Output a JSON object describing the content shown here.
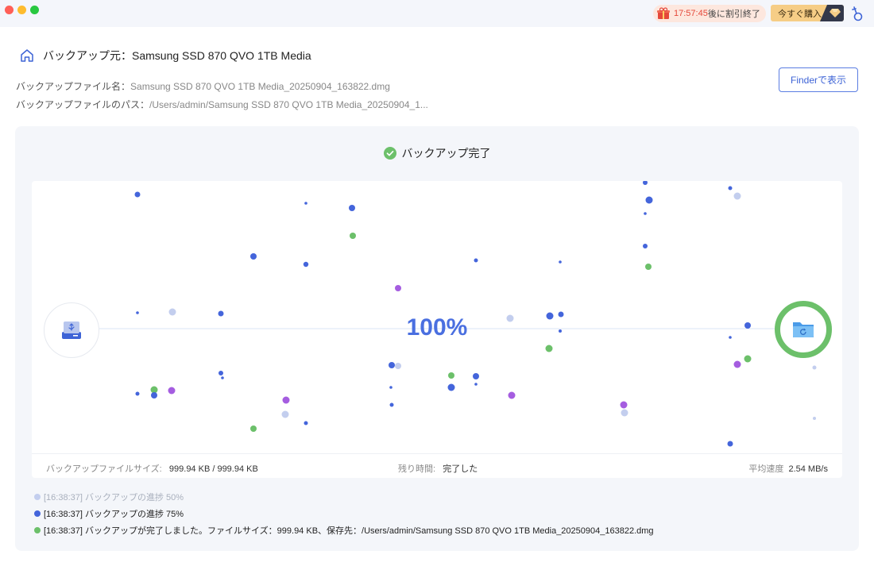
{
  "titlebar": {
    "promo": {
      "timer": "17:57:45",
      "suffix": "後に割引終了"
    },
    "buy_label": "今すぐ購入",
    "icons": [
      "gift-icon",
      "diamond-icon",
      "account-icon"
    ]
  },
  "header": {
    "source_label": "バックアップ元：",
    "source_value": "Samsung SSD 870 QVO 1TB Media"
  },
  "info": {
    "file_name_label": "バックアップファイル名：",
    "file_name_value": "Samsung SSD 870 QVO 1TB Media_20250904_163822.dmg",
    "path_label": "バックアップファイルのパス：",
    "path_value": "/Users/admin/Samsung SSD 870 QVO 1TB Media_20250904_1..."
  },
  "finder_button_label": "Finderで表示",
  "status": {
    "text": "バックアップ完了"
  },
  "progress": {
    "percent_text": "100%",
    "value": 1.0
  },
  "stats": {
    "size_label": "バックアップファイルサイズ:",
    "size_value": "999.94 KB / 999.94 KB",
    "remaining_label": "残り時間:",
    "remaining_value": "完了した",
    "speed_label": "平均速度",
    "speed_value": "2.54 MB/s"
  },
  "log": [
    {
      "text": "[16:38:37] バックアップの進捗 50%"
    },
    {
      "text": "[16:38:37] バックアップの進捗 75%"
    },
    {
      "text": "[16:38:37] バックアップが完了しました。ファイルサイズ：999.94 KB、保存先：/Users/admin/Samsung SSD 870 QVO 1TB Media_20250904_163822.dmg"
    }
  ],
  "colors": {
    "accent": "#4a6fe0",
    "success": "#6cc06a",
    "dot_blue": "#4465db",
    "dot_light": "#c3ceee",
    "dot_green": "#6cc06a",
    "dot_purple": "#a55de0"
  }
}
